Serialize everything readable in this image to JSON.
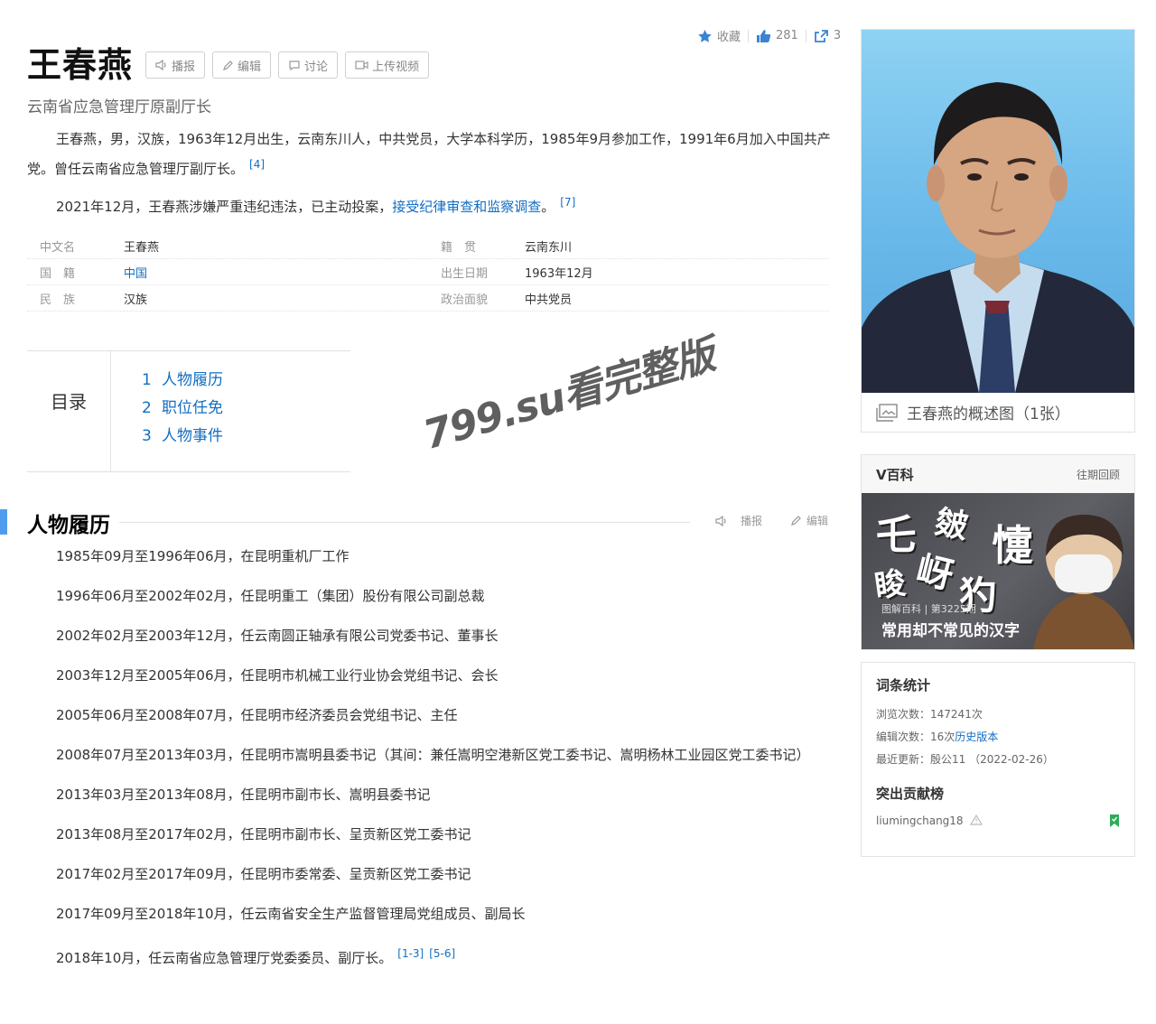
{
  "title": "王春燕",
  "title_buttons": {
    "broadcast": "播报",
    "edit": "编辑",
    "discuss": "讨论",
    "upload": "上传视频"
  },
  "top_actions": {
    "favorite": "收藏",
    "likes": "281",
    "shares": "3"
  },
  "subtitle": "云南省应急管理厅原副厅长",
  "summary": {
    "p1": "王春燕，男，汉族，1963年12月出生，云南东川人，中共党员，大学本科学历，1985年9月参加工作，1991年6月加入中国共产党。曾任云南省应急管理厅副厅长。",
    "p1_ref": "[4]",
    "p2_prefix": "2021年12月，王春燕涉嫌严重违纪违法，已主动投案，",
    "p2_link": "接受纪律审查和监察调查",
    "p2_suffix": "。",
    "p2_ref": "[7]"
  },
  "info_rows": [
    {
      "k1": "中文名",
      "v1": "王春燕",
      "k2": "籍　贯",
      "v2": "云南东川"
    },
    {
      "k1": "国　籍",
      "v1": "中国",
      "k2": "出生日期",
      "v2": "1963年12月"
    },
    {
      "k1": "民　族",
      "v1": "汉族",
      "k2": "政治面貌",
      "v2": "中共党员"
    }
  ],
  "toc": {
    "label": "目录",
    "items": [
      {
        "num": "1",
        "label": "人物履历"
      },
      {
        "num": "2",
        "label": "职位任免"
      },
      {
        "num": "3",
        "label": "人物事件"
      }
    ]
  },
  "section": {
    "title": "人物履历",
    "broadcast": "播报",
    "edit": "编辑"
  },
  "career": [
    "1985年09月至1996年06月，在昆明重机厂工作",
    "1996年06月至2002年02月，任昆明重工（集团）股份有限公司副总裁",
    "2002年02月至2003年12月，任云南圆正轴承有限公司党委书记、董事长",
    "2003年12月至2005年06月，任昆明市机械工业行业协会党组书记、会长",
    "2005年06月至2008年07月，任昆明市经济委员会党组书记、主任",
    "2008年07月至2013年03月，任昆明市嵩明县委书记（其间：兼任嵩明空港新区党工委书记、嵩明杨林工业园区党工委书记）",
    "2013年03月至2013年08月，任昆明市副市长、嵩明县委书记",
    "2013年08月至2017年02月，任昆明市副市长、呈贡新区党工委书记",
    "2017年02月至2017年09月，任昆明市委常委、呈贡新区党工委书记",
    "2017年09月至2018年10月，任云南省安全生产监督管理局党组成员、副局长",
    "2018年10月，任云南省应急管理厅党委委员、副厅长。"
  ],
  "career_refs": [
    "[1-3]",
    "[5-6]"
  ],
  "watermark": "799.su看完整版",
  "photo_caption": "王春燕的概述图（1张）",
  "vbaike": {
    "title": "V百科",
    "more": "往期回顾",
    "chars": [
      "乇",
      "皴",
      "懥",
      "睃",
      "岈",
      "犳"
    ],
    "tag": "图解百科 | 第3225期",
    "caption": "常用却不常见的汉字"
  },
  "stats": {
    "title": "词条统计",
    "views_label": "浏览次数：",
    "views": "147241次",
    "edits_label": "编辑次数：",
    "edits": "16次",
    "history_link": "历史版本",
    "updated_label": "最近更新：",
    "updated": "殷公11 （2022-02-26）",
    "contrib_title": "突出贡献榜",
    "contributor": "liumingchang18"
  },
  "colors": {
    "link": "#136ec2",
    "accent_bar": "#4f9cee"
  }
}
